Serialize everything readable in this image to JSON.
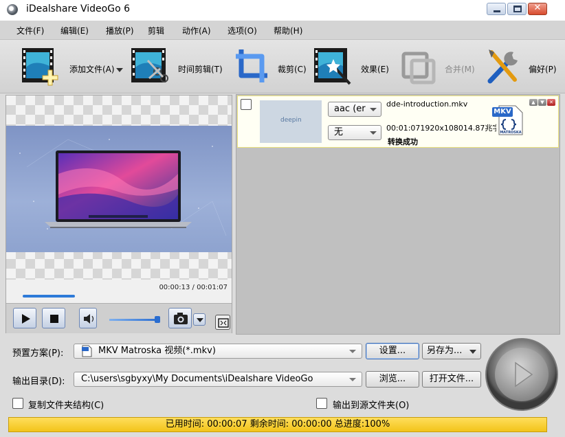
{
  "window": {
    "title": "iDealshare VideoGo 6"
  },
  "menu": [
    "文件(F)",
    "编辑(E)",
    "播放(P)",
    "剪辑",
    "动作(A)",
    "选项(O)",
    "帮助(H)"
  ],
  "toolbar": {
    "add_file": "添加文件(A)",
    "trim": "时间剪辑(T)",
    "crop": "裁剪(C)",
    "effect": "效果(E)",
    "merge": "合并(M)",
    "preferences": "偏好(P)"
  },
  "preview": {
    "time": "00:00:13 / 00:01:07",
    "progress_percent": 19.4,
    "volume_percent": 100
  },
  "file": {
    "thumbnail_text": "deepin",
    "audio_track": "aac (er",
    "subtitle": "无",
    "name": "dde-introduction.mkv",
    "info": "00:01:071920x108014.87兆字节",
    "status": "转换成功",
    "badge_text": "MKV",
    "badge_sub": "MATROSKA"
  },
  "bottom": {
    "preset_label": "预置方案(P):",
    "preset_value": "MKV Matroska 视频(*.mkv)",
    "settings_button": "设置...",
    "save_as_button": "另存为...",
    "output_label": "输出目录(D):",
    "output_value": "C:\\users\\sgbyxy\\My Documents\\iDealshare VideoGo",
    "browse_button": "浏览...",
    "open_folder_button": "打开文件...",
    "copy_structure_label": "复制文件夹结构(C)",
    "output_source_label": "输出到源文件夹(O)",
    "status": "已用时间: 00:00:07 剩余时间: 00:00:00 总进度:100%"
  },
  "colors": {
    "status_bar": "#f2c419",
    "selection_border": "#e9e07a",
    "accent_blue": "#2d7ad8"
  }
}
